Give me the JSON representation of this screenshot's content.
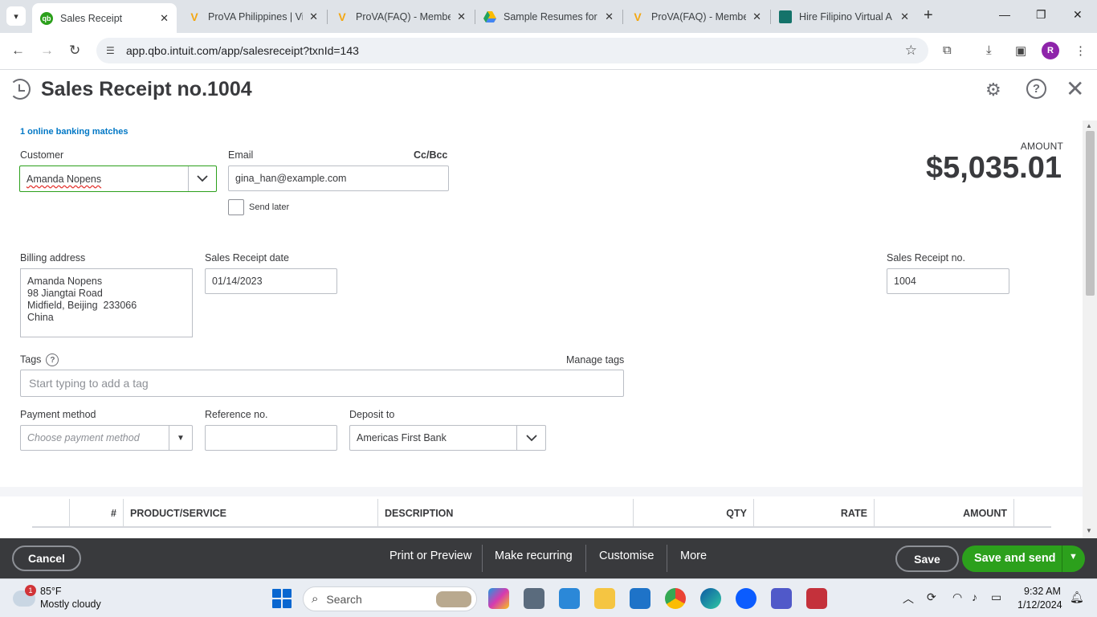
{
  "browser": {
    "tabs": [
      {
        "title": "Sales Receipt",
        "favicon": "quickbooks-icon"
      },
      {
        "title": "ProVA Philippines | Vi",
        "favicon": "prova-icon"
      },
      {
        "title": "ProVA(FAQ) - Membe",
        "favicon": "prova-icon"
      },
      {
        "title": "Sample Resumes for",
        "favicon": "google-drive-icon"
      },
      {
        "title": "ProVA(FAQ) - Membe",
        "favicon": "prova-icon"
      },
      {
        "title": "Hire Filipino Virtual A",
        "favicon": "hire-filipino-icon"
      }
    ],
    "url": "app.qbo.intuit.com/app/salesreceipt?txnId=143",
    "profile_initial": "R"
  },
  "header": {
    "title": "Sales Receipt no.1004"
  },
  "form": {
    "banking_matches": "1 online banking matches",
    "customer_label": "Customer",
    "customer_value": "Amanda Nopens",
    "email_label": "Email",
    "cc_bcc": "Cc/Bcc",
    "email_value": "gina_han@example.com",
    "send_later": "Send later",
    "amount_label": "AMOUNT",
    "amount_value": "$5,035.01",
    "billing_label": "Billing address",
    "billing_lines": [
      "Amanda Nopens",
      "98 Jiangtai Road",
      "Midfield, Beijing  233066",
      "China"
    ],
    "date_label": "Sales Receipt date",
    "date_value": "01/14/2023",
    "receipt_no_label": "Sales Receipt no.",
    "receipt_no_value": "1004",
    "tags_label": "Tags",
    "manage_tags": "Manage tags",
    "tags_placeholder": "Start typing to add a tag",
    "payment_method_label": "Payment method",
    "payment_method_placeholder": "Choose payment method",
    "reference_label": "Reference no.",
    "reference_value": "",
    "deposit_label": "Deposit to",
    "deposit_value": "Americas First Bank"
  },
  "table": {
    "columns": [
      "#",
      "PRODUCT/SERVICE",
      "DESCRIPTION",
      "QTY",
      "RATE",
      "AMOUNT"
    ]
  },
  "footer": {
    "cancel": "Cancel",
    "print_preview": "Print or Preview",
    "make_recurring": "Make recurring",
    "customise": "Customise",
    "more": "More",
    "save": "Save",
    "save_and_send": "Save and send"
  },
  "taskbar": {
    "weather_badge": "1",
    "temperature": "85°F",
    "weather": "Mostly cloudy",
    "search": "Search",
    "time": "9:32 AM",
    "date": "1/12/2024"
  },
  "colors": {
    "brand_green": "#2ca01c",
    "link_blue": "#0077c5",
    "footer_bg": "#393a3d"
  }
}
